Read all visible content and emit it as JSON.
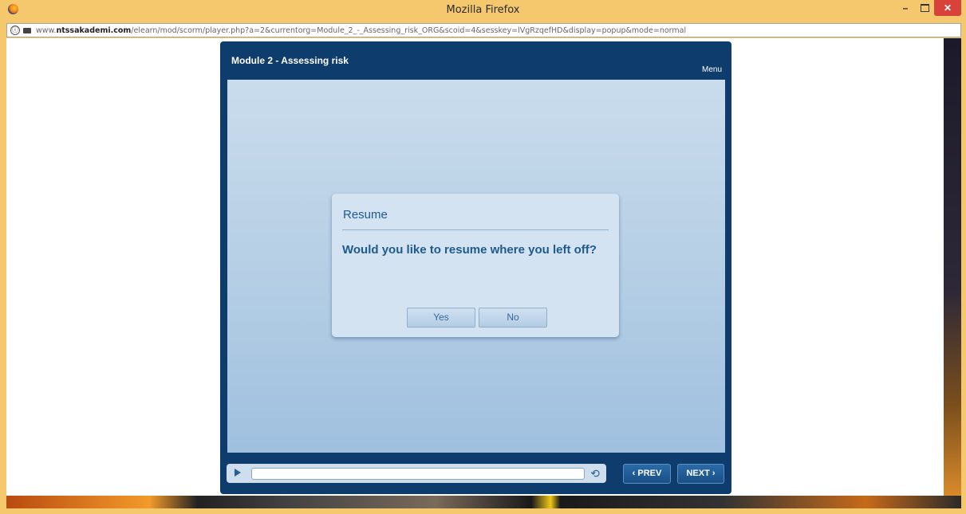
{
  "window": {
    "title": "Mozilla Firefox",
    "minimize": "–",
    "close": "✕"
  },
  "address_bar": {
    "info_icon": "ⓘ",
    "url_prefix": "www.",
    "url_host": "ntssakademi.com",
    "url_path": "/elearn/mod/scorm/player.php?a=2&currentorg=Module_2_-_Assessing_risk_ORG&scoid=4&sesskey=lVgRzqefHD&display=popup&mode=normal"
  },
  "player": {
    "title": "Module 2 - Assessing risk",
    "menu_label": "Menu"
  },
  "dialog": {
    "heading": "Resume",
    "question": "Would you like to resume where you left off?",
    "yes_label": "Yes",
    "no_label": "No"
  },
  "controls": {
    "replay_icon": "⟲",
    "prev_label": "‹ PREV",
    "next_label": "NEXT ›"
  },
  "colors": {
    "window_frame": "#f5c86e",
    "player_frame": "#0e3c6c",
    "dialog_text": "#1f5a8e",
    "close_button": "#d9423a"
  }
}
